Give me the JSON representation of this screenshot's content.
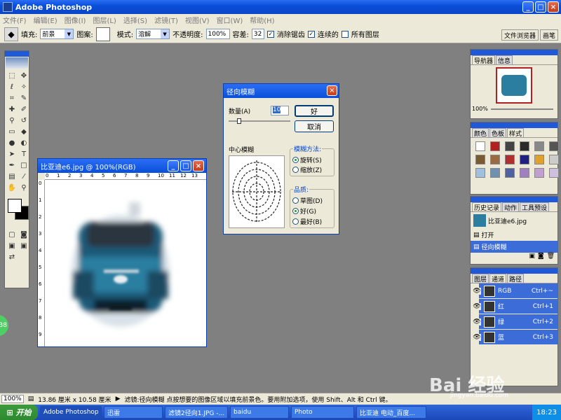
{
  "app": {
    "title": "Adobe Photoshop"
  },
  "menu": [
    "文件(F)",
    "编辑(E)",
    "图像(I)",
    "图层(L)",
    "选择(S)",
    "滤镜(T)",
    "视图(V)",
    "窗口(W)",
    "帮助(H)"
  ],
  "options": {
    "fill_label": "填充:",
    "fill_value": "前景",
    "pattern_label": "图案:",
    "mode_label": "模式:",
    "mode_value": "溶解",
    "opacity_label": "不透明度:",
    "opacity_value": "100%",
    "tolerance_label": "容差:",
    "tolerance_value": "32",
    "antialias_label": "消除锯齿",
    "contiguous_label": "连续的",
    "all_layers_label": "所有图层"
  },
  "palette_well": [
    "文件浏览器",
    "画笔"
  ],
  "image_window": {
    "title": "比亚迪e6.jpg @ 100%(RGB)",
    "ruler_h": [
      "0",
      "1",
      "2",
      "3",
      "4",
      "5",
      "6",
      "7",
      "8",
      "9",
      "10",
      "11",
      "12",
      "13"
    ],
    "ruler_v": [
      "0",
      "1",
      "2",
      "3",
      "4",
      "5",
      "6",
      "7",
      "8",
      "9"
    ]
  },
  "dialog": {
    "title": "径向模糊",
    "amount_label": "数量(A)",
    "amount_value": "10",
    "ok": "好",
    "cancel": "取消",
    "center_label": "中心模糊",
    "method_label": "模糊方法:",
    "method_spin": "旋转(S)",
    "method_zoom": "缩放(Z)",
    "quality_label": "品质:",
    "q_draft": "草图(D)",
    "q_good": "好(G)",
    "q_best": "最好(B)"
  },
  "navigator": {
    "tabs": [
      "导航器",
      "信息"
    ],
    "zoom": "100%"
  },
  "swatches": {
    "tabs": [
      "颜色",
      "色板",
      "样式"
    ],
    "colors": [
      "#ffffff",
      "#b22020",
      "#444444",
      "#2a2a2a",
      "#888888",
      "#555555",
      "#7a5a30",
      "#9a6a40",
      "#b03030",
      "#202080",
      "#e0a030",
      "#cccccc",
      "#a0c0e0",
      "#7090b0",
      "#5060a0",
      "#a080c0",
      "#c0a0d0",
      "#d0c0e0"
    ]
  },
  "history": {
    "tabs": [
      "历史记录",
      "动作",
      "工具预设"
    ],
    "doc": "比亚迪e6.jpg",
    "items": [
      "打开",
      "径向模糊"
    ]
  },
  "layers": {
    "tabs": [
      "图层",
      "通道",
      "路径"
    ],
    "channels": [
      {
        "name": "RGB",
        "sc": "Ctrl+~"
      },
      {
        "name": "红",
        "sc": "Ctrl+1"
      },
      {
        "name": "绿",
        "sc": "Ctrl+2"
      },
      {
        "name": "蓝",
        "sc": "Ctrl+3"
      }
    ]
  },
  "status": {
    "zoom": "100%",
    "size": "13.86 厘米 x 10.58 厘米",
    "hint": "滤镜:径向模糊   点按想要的图像区域以填充前景色。要用附加选项，使用 Shift、Alt 和 Ctrl 键。"
  },
  "taskbar": {
    "start": "开始",
    "tasks": [
      "Adobe Photoshop",
      "迅雷",
      "滤镜2径向1.JPG -...",
      "baidu",
      "Photo",
      "比亚迪 电动_百度..."
    ],
    "time": "18:23"
  },
  "side_badge": "38",
  "watermark": {
    "text": "Bai 经验",
    "sub": "jingyan.baidu.com"
  }
}
